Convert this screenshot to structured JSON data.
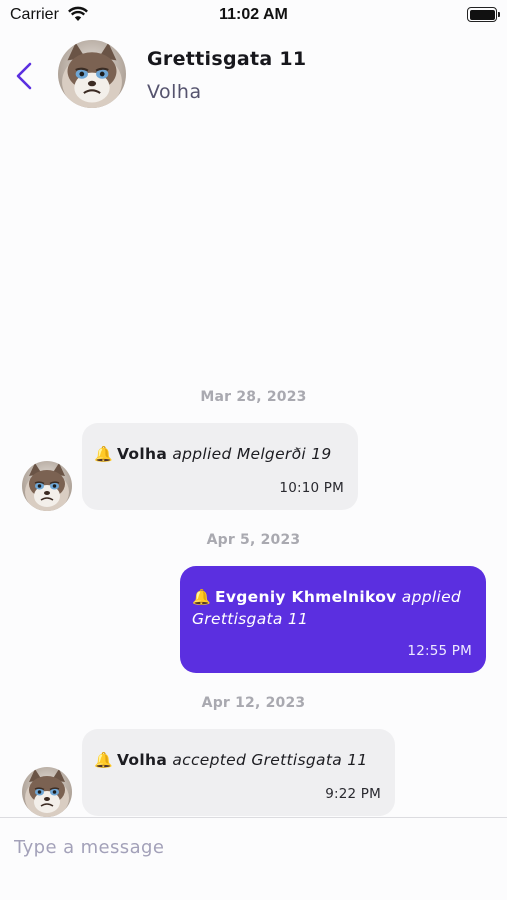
{
  "status_bar": {
    "carrier": "Carrier",
    "time": "11:02 AM"
  },
  "header": {
    "title": "Grettisgata 11",
    "subtitle": "Volha",
    "back_icon": "chevron-left-icon"
  },
  "messages": [
    {
      "date": "Mar 28, 2023",
      "direction": "incoming",
      "icon": "bell-icon",
      "actor": "Volha",
      "action": "applied Melgerði 19",
      "time": "10:10 PM"
    },
    {
      "date": "Apr 5, 2023",
      "direction": "outgoing",
      "icon": "bell-icon",
      "actor": "Evgeniy Khmelnikov",
      "action_line1": "applied",
      "action_line2": "Grettisgata 11",
      "time": "12:55 PM"
    },
    {
      "date": "Apr 12, 2023",
      "direction": "incoming",
      "icon": "bell-icon",
      "actor": "Volha",
      "action": "accepted Grettisgata 11",
      "time": "9:22 PM"
    }
  ],
  "composer": {
    "placeholder": "Type a message"
  },
  "colors": {
    "accent": "#5b2fe0",
    "incoming_bubble": "#efeff1",
    "background": "#fcfcfd"
  }
}
